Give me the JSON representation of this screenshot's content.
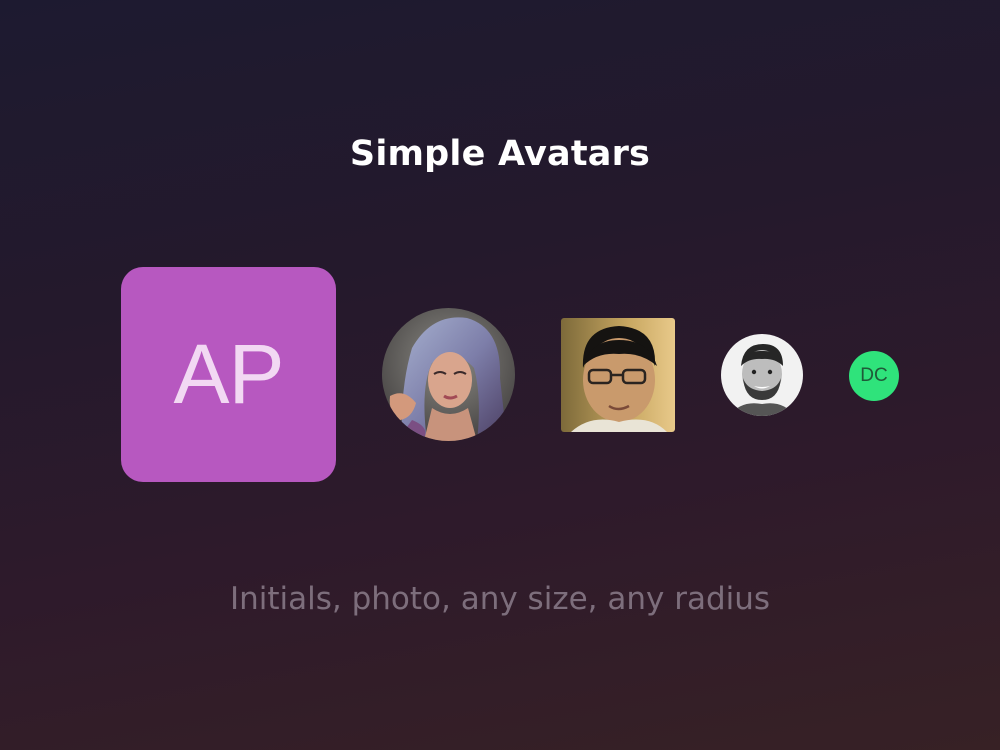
{
  "title": "Simple Avatars",
  "subtitle": "Initials, photo, any size, any radius",
  "avatars": [
    {
      "kind": "initials",
      "text": "AP",
      "bg": "#b758c0",
      "fg": "#f2d8f3"
    },
    {
      "kind": "photo",
      "subject": "woman with blue-lavender hair"
    },
    {
      "kind": "photo",
      "subject": "man with glasses"
    },
    {
      "kind": "photo",
      "subject": "bearded man, black and white"
    },
    {
      "kind": "initials",
      "text": "DC",
      "bg": "#2fe37b",
      "fg": "#1f5a38"
    }
  ],
  "colors": {
    "title": "#ffffff",
    "subtitle": "#7d6e7c",
    "bg_top": "#1d1a30",
    "bg_bottom": "#372125"
  }
}
